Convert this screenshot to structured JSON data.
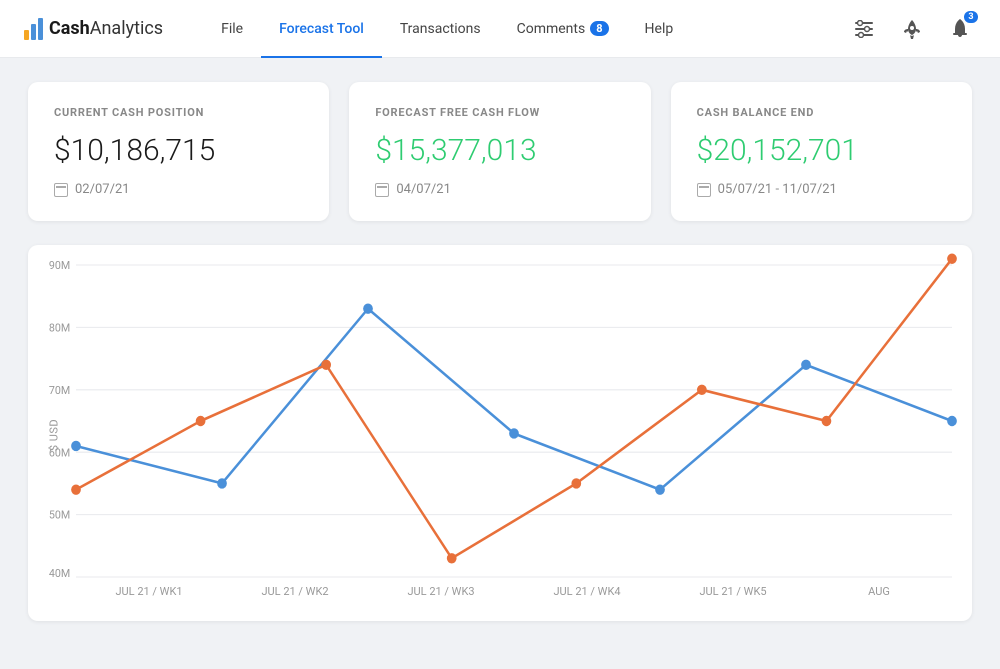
{
  "app": {
    "logo_text_regular": "Cash",
    "logo_text_bold": "Analytics"
  },
  "navbar": {
    "links": [
      {
        "id": "file",
        "label": "File",
        "active": false,
        "badge": null
      },
      {
        "id": "forecast-tool",
        "label": "Forecast Tool",
        "active": true,
        "badge": null
      },
      {
        "id": "transactions",
        "label": "Transactions",
        "active": false,
        "badge": null
      },
      {
        "id": "comments",
        "label": "Comments",
        "active": false,
        "badge": "8"
      },
      {
        "id": "help",
        "label": "Help",
        "active": false,
        "badge": null
      }
    ],
    "icons": {
      "settings": "⊞",
      "rocket": "🚀",
      "bell_badge": "3"
    }
  },
  "cards": [
    {
      "id": "current-cash-position",
      "label": "CURRENT CASH POSITION",
      "value": "$10,186,715",
      "value_color": "dark",
      "date": "02/07/21"
    },
    {
      "id": "forecast-free-cash-flow",
      "label": "FORECAST FREE CASH FLOW",
      "value": "$15,377,013",
      "value_color": "green",
      "date": "04/07/21"
    },
    {
      "id": "cash-balance-end",
      "label": "CASH BALANCE END",
      "value": "$20,152,701",
      "value_color": "green",
      "date": "05/07/21 - 11/07/21"
    }
  ],
  "chart": {
    "y_label": "$ USD",
    "y_ticks": [
      "90M",
      "80M",
      "70M",
      "60M",
      "50M",
      "40M"
    ],
    "x_labels": [
      "JUL 21 / WK1",
      "JUL 21 / WK2",
      "JUL 21 / WK3",
      "JUL 21 / WK4",
      "JUL 21 / WK5",
      "AUG"
    ],
    "blue_series": [
      61,
      55,
      83,
      63,
      54,
      74,
      65
    ],
    "orange_series": [
      54,
      65,
      74,
      43,
      55,
      70,
      65,
      91
    ]
  },
  "colors": {
    "blue_line": "#4a90d9",
    "orange_line": "#e8703a",
    "grid_line": "#e8eaed",
    "accent": "#1a73e8"
  }
}
